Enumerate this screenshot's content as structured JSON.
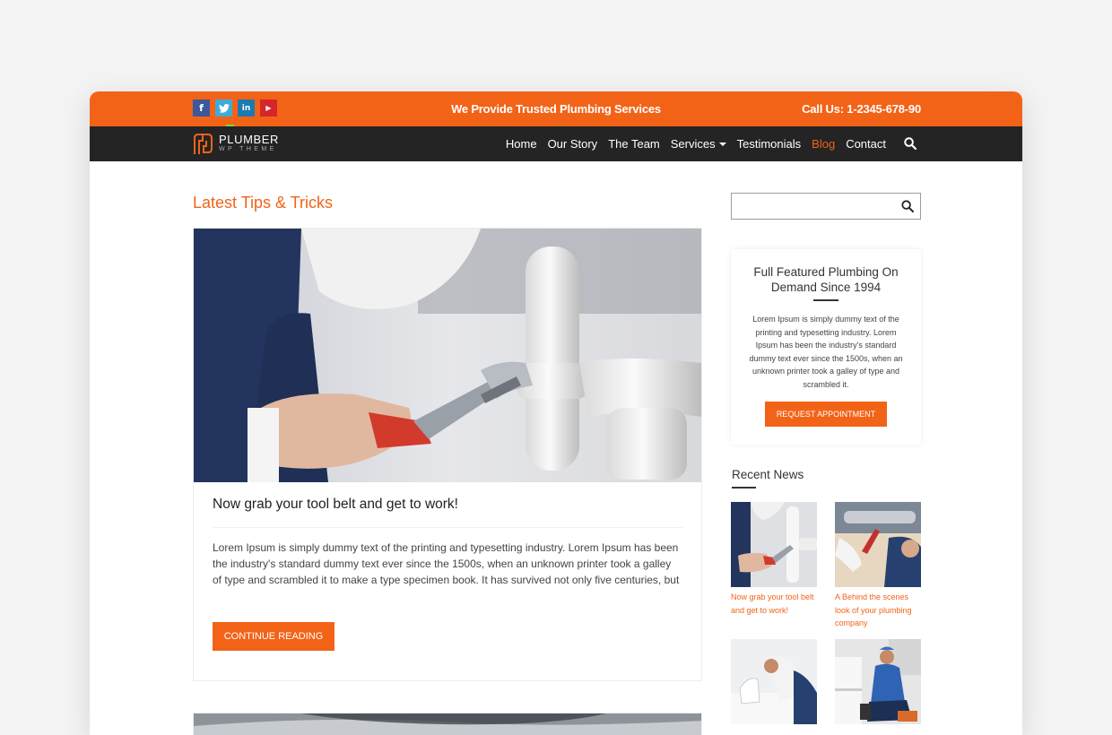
{
  "colors": {
    "accent": "#f26318",
    "navbar": "#242424",
    "page_bg": "#f3f3f3"
  },
  "topbar": {
    "social": [
      {
        "name": "facebook-icon",
        "glyph": "f"
      },
      {
        "name": "twitter-icon",
        "glyph": "t"
      },
      {
        "name": "linkedin-icon",
        "glyph": "in"
      },
      {
        "name": "youtube-icon",
        "glyph": "▶"
      }
    ],
    "tagline": "We Provide Trusted Plumbing Services",
    "phone": "Call Us: 1-2345-678-90"
  },
  "brand": {
    "name": "PLUMBER",
    "sub": "WP THEME"
  },
  "nav": {
    "items": [
      {
        "label": "Home"
      },
      {
        "label": "Our Story"
      },
      {
        "label": "The Team"
      },
      {
        "label": "Services"
      },
      {
        "label": "Testimonials"
      },
      {
        "label": "Blog"
      },
      {
        "label": "Contact"
      }
    ],
    "search_icon": "search-icon"
  },
  "main": {
    "section_title": "Latest Tips & Tricks",
    "post": {
      "title": "Now grab your tool belt and get to work!",
      "excerpt": "Lorem Ipsum is simply dummy text of the printing and typesetting industry. Lorem Ipsum has been the industry's standard dummy text ever since the 1500s, when an unknown printer took a galley of type and scrambled it to make a type specimen book. It has survived not only five centuries, but",
      "button": "CONTINUE READING"
    }
  },
  "sidebar": {
    "search": {
      "placeholder": ""
    },
    "promo": {
      "title": "Full Featured Plumbing On Demand Since 1994",
      "text": "Lorem Ipsum is simply dummy text of the printing and typesetting industry. Lorem Ipsum has been the industry's standard dummy text ever since the 1500s, when an unknown printer took a galley of type and scrambled it.",
      "button": "REQUEST APPOINTMENT"
    },
    "recent": {
      "title": "Recent News",
      "items": [
        {
          "caption": "Now grab your tool belt and get to work!"
        },
        {
          "caption": "A Behind the scenes look of your plumbing company"
        }
      ]
    }
  }
}
